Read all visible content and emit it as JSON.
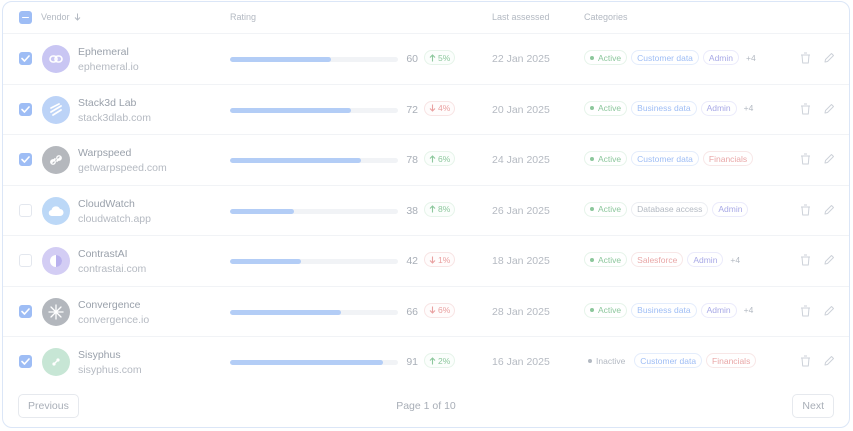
{
  "header": {
    "vendor": "Vendor",
    "rating": "Rating",
    "last_assessed": "Last assessed",
    "categories": "Categories"
  },
  "rows": [
    {
      "checked": true,
      "name": "Ephemeral",
      "domain": "ephemeral.io",
      "logo_color": "#c9c6f3",
      "logo_icon": "link-icon",
      "rating": 60,
      "delta": "5%",
      "delta_dir": "up",
      "date": "22 Jan 2025",
      "status": "Active",
      "tags": [
        {
          "label": "Customer data",
          "tone": "blue"
        },
        {
          "label": "Admin",
          "tone": "purple"
        }
      ],
      "more": "+4"
    },
    {
      "checked": true,
      "name": "Stack3d Lab",
      "domain": "stack3dlab.com",
      "logo_color": "#bcd3f7",
      "logo_icon": "stack-icon",
      "rating": 72,
      "delta": "4%",
      "delta_dir": "down",
      "date": "20 Jan 2025",
      "status": "Active",
      "tags": [
        {
          "label": "Business data",
          "tone": "blue"
        },
        {
          "label": "Admin",
          "tone": "purple"
        }
      ],
      "more": "+4"
    },
    {
      "checked": true,
      "name": "Warpspeed",
      "domain": "getwarpspeed.com",
      "logo_color": "#b5b8bd",
      "logo_icon": "chain-icon",
      "rating": 78,
      "delta": "6%",
      "delta_dir": "up",
      "date": "24 Jan 2025",
      "status": "Active",
      "tags": [
        {
          "label": "Customer data",
          "tone": "blue"
        },
        {
          "label": "Financials",
          "tone": "red"
        }
      ],
      "more": ""
    },
    {
      "checked": false,
      "name": "CloudWatch",
      "domain": "cloudwatch.app",
      "logo_color": "#bcd8f7",
      "logo_icon": "cloud-icon",
      "rating": 38,
      "delta": "8%",
      "delta_dir": "up",
      "date": "26 Jan 2025",
      "status": "Active",
      "tags": [
        {
          "label": "Database access",
          "tone": "plain"
        },
        {
          "label": "Admin",
          "tone": "purple"
        }
      ],
      "more": ""
    },
    {
      "checked": false,
      "name": "ContrastAI",
      "domain": "contrastai.com",
      "logo_color": "#d3cdf4",
      "logo_icon": "contrast-icon",
      "rating": 42,
      "delta": "1%",
      "delta_dir": "down",
      "date": "18 Jan 2025",
      "status": "Active",
      "tags": [
        {
          "label": "Salesforce",
          "tone": "red"
        },
        {
          "label": "Admin",
          "tone": "purple"
        }
      ],
      "more": "+4"
    },
    {
      "checked": true,
      "name": "Convergence",
      "domain": "convergence.io",
      "logo_color": "#b3b7bd",
      "logo_icon": "burst-icon",
      "rating": 66,
      "delta": "6%",
      "delta_dir": "down",
      "date": "28 Jan 2025",
      "status": "Active",
      "tags": [
        {
          "label": "Business data",
          "tone": "blue"
        },
        {
          "label": "Admin",
          "tone": "purple"
        }
      ],
      "more": "+4"
    },
    {
      "checked": true,
      "name": "Sisyphus",
      "domain": "sisyphus.com",
      "logo_color": "#c7e6d5",
      "logo_icon": "leaf-icon",
      "rating": 91,
      "delta": "2%",
      "delta_dir": "up",
      "date": "16 Jan 2025",
      "status": "Inactive",
      "tags": [
        {
          "label": "Customer data",
          "tone": "blue"
        },
        {
          "label": "Financials",
          "tone": "red"
        }
      ],
      "more": ""
    }
  ],
  "footer": {
    "previous": "Previous",
    "page_info": "Page 1 of 10",
    "next": "Next"
  }
}
